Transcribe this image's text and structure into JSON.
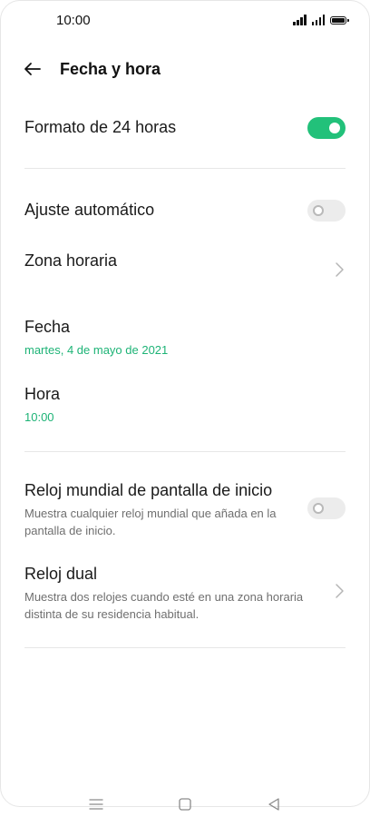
{
  "status_bar": {
    "time": "10:00",
    "icons": [
      "signal-icon",
      "signal-icon",
      "battery-icon"
    ]
  },
  "header": {
    "title": "Fecha y hora",
    "back_icon": "back-arrow-icon"
  },
  "settings": {
    "format_24h": {
      "label": "Formato de 24 horas",
      "enabled": true
    },
    "auto_adjust": {
      "label": "Ajuste automático",
      "enabled": false
    },
    "time_zone": {
      "label": "Zona horaria"
    },
    "date": {
      "label": "Fecha",
      "value": "martes, 4 de mayo de 2021"
    },
    "time": {
      "label": "Hora",
      "value": "10:00"
    },
    "world_clock": {
      "label": "Reloj mundial de pantalla de inicio",
      "description": "Muestra cualquier reloj mundial que añada en la pantalla de inicio.",
      "enabled": false
    },
    "dual_clock": {
      "label": "Reloj dual",
      "description": "Muestra dos relojes cuando esté en una zona horaria distinta de su residencia habitual."
    }
  },
  "nav_bar": {
    "icons": [
      "menu-icon",
      "home-icon",
      "back-triangle-icon"
    ]
  },
  "colors": {
    "accent": "#22c17a",
    "value_text": "#1db376",
    "toggle_off": "#ececec",
    "description": "#6f6f6f",
    "divider": "#e7e7e7"
  }
}
